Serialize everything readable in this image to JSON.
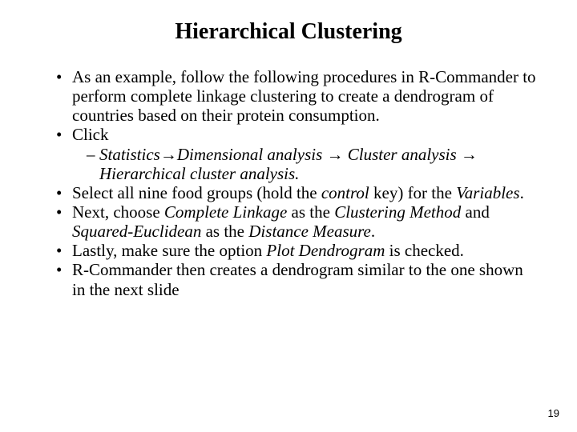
{
  "title": "Hierarchical Clustering",
  "b1_a": "As an example, follow the following procedures in R-Commander to perform complete linkage clustering to create a dendrogram of countries based on their protein consumption.",
  "b2": "Click",
  "b2s_a": "Statistics→Dimensional analysis → Cluster analysis → Hierarchical cluster analysis.",
  "b3_a": "Select all nine food groups (hold the ",
  "b3_b": "control",
  "b3_c": " key) for the ",
  "b3_d": "Variables",
  "b3_e": ".",
  "b4_a": "Next, choose ",
  "b4_b": "Complete Linkage",
  "b4_c": " as the ",
  "b4_d": "Clustering Method",
  "b4_e": " and ",
  "b4_f": "Squared-Euclidean",
  "b4_g": " as the ",
  "b4_h": "Distance Measure",
  "b4_i": ".",
  "b5_a": "Lastly, make sure the option ",
  "b5_b": "Plot Dendrogram",
  "b5_c": " is checked.",
  "b6": "R-Commander then creates a dendrogram similar to the one shown in the next slide",
  "page": "19"
}
